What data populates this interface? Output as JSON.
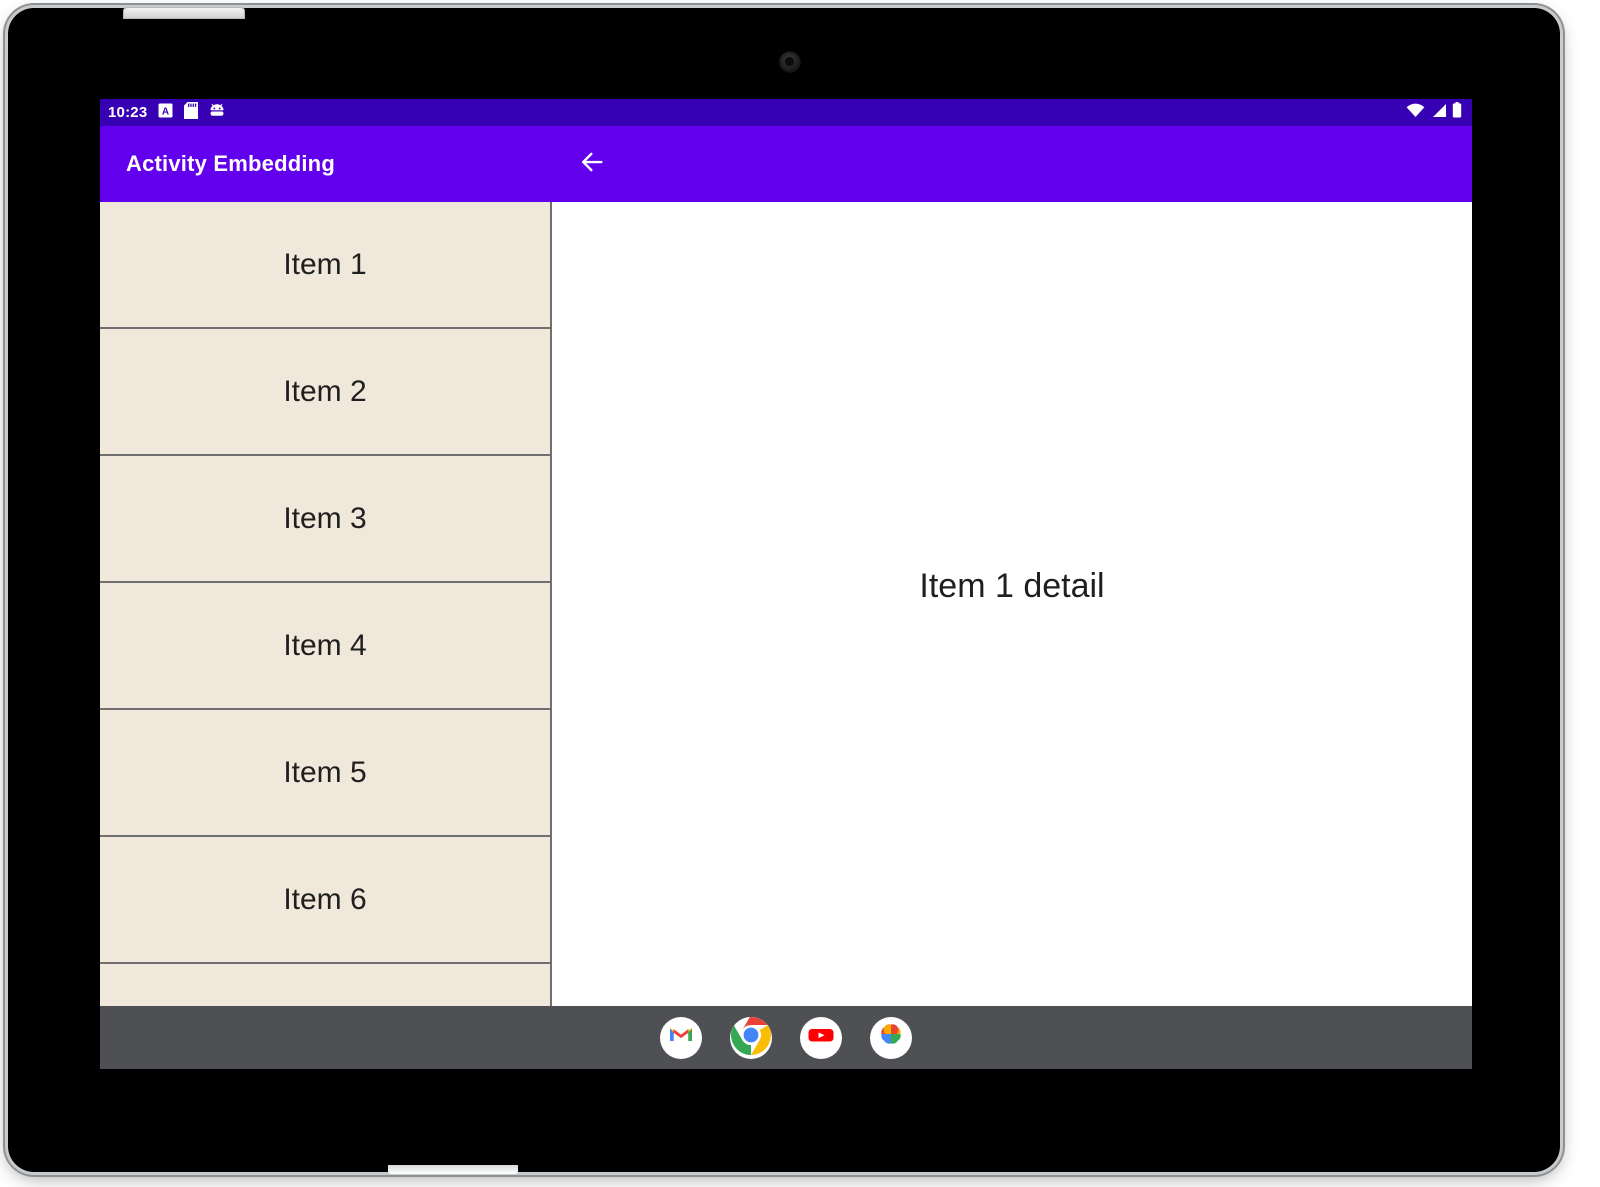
{
  "device": {
    "type": "android-tablet",
    "camera": "front-camera"
  },
  "status_bar": {
    "clock": "10:23",
    "left_icons": [
      "a-box-icon",
      "sd-card-icon",
      "android-head-icon"
    ],
    "right_icons": [
      "wifi-icon",
      "cellular-signal-icon",
      "battery-icon"
    ],
    "background": "#3700B3"
  },
  "app_bar": {
    "title": "Activity Embedding",
    "back_icon": "arrow-left-icon",
    "background": "#6200EE",
    "text_color": "#FFFFFF"
  },
  "list_pane": {
    "background": "#F0E8DA",
    "divider_color": "#6F6F6F",
    "items": [
      {
        "label": "Item 1"
      },
      {
        "label": "Item 2"
      },
      {
        "label": "Item 3"
      },
      {
        "label": "Item 4"
      },
      {
        "label": "Item 5"
      },
      {
        "label": "Item 6"
      },
      {
        "label": ""
      }
    ]
  },
  "detail_pane": {
    "text": "Item 1 detail",
    "background": "#FFFFFF"
  },
  "taskbar": {
    "background": "#4E5053",
    "apps": [
      {
        "name": "Gmail",
        "icon": "gmail-icon"
      },
      {
        "name": "Chrome",
        "icon": "chrome-icon"
      },
      {
        "name": "YouTube",
        "icon": "youtube-icon"
      },
      {
        "name": "Photos",
        "icon": "google-photos-icon"
      }
    ]
  }
}
